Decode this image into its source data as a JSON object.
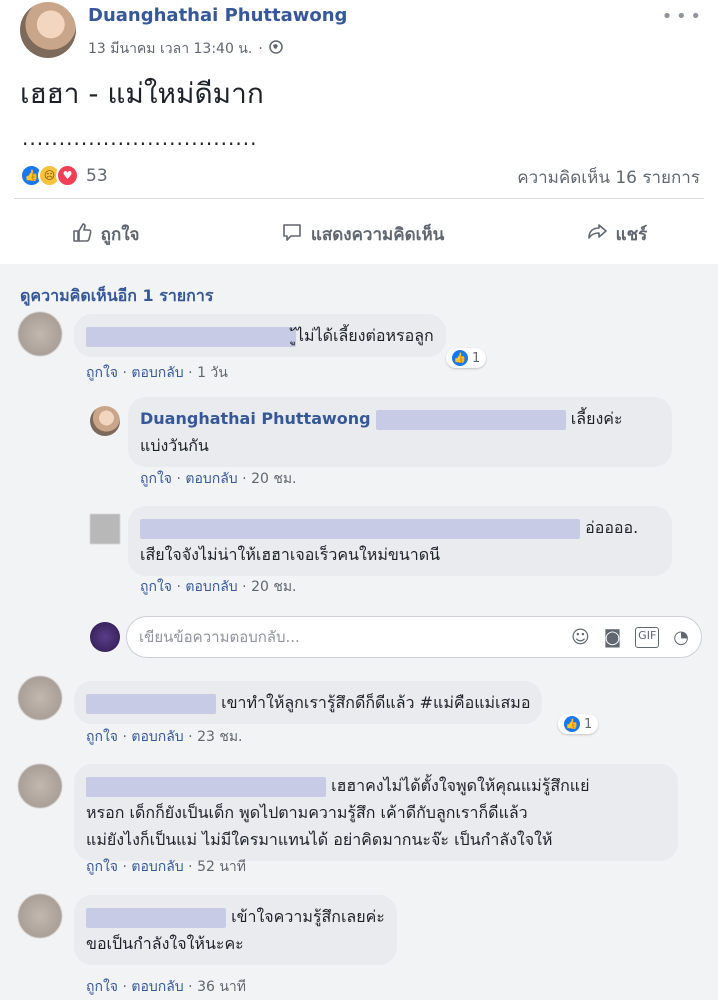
{
  "post": {
    "author": "Duanghathai Phuttawong",
    "timestamp": "13 มีนาคม เวลา 13:40 น.",
    "privacy_icon": "globe-icon",
    "text": "เฮฮา - แม่ใหม่ดีมาก",
    "dotted_line": "................................",
    "reaction_count": "53",
    "comment_count": "ความคิดเห็น 16 รายการ",
    "more_icon": "more-dots-icon"
  },
  "actions": {
    "like": "ถูกใจ",
    "comment": "แสดงความคิดเห็น",
    "share": "แชร์"
  },
  "view_more": "ดูความคิดเห็นอีก 1 รายการ",
  "comments": [
    {
      "text": "ู้ไม่ได้เลี้ยงต่อหรอลูก",
      "like": "ถูกใจ",
      "reply": "ตอบกลับ",
      "time": "1 วัน",
      "likes": "1",
      "replies": [
        {
          "name": "Duanghathai Phuttawong",
          "text_end": "เลี้ยงค่ะ",
          "text2": "แบ่งวันกัน",
          "like": "ถูกใจ",
          "reply": "ตอบกลับ",
          "time": "20 ชม."
        },
        {
          "text_end": "อ่ออออ.",
          "text2": "เสียใจจังไม่น่าให้เฮฮาเจอเร็วคนใหม่ขนาดนี",
          "like": "ถูกใจ",
          "reply": "ตอบกลับ",
          "time": "20 ชม."
        }
      ]
    },
    {
      "text": "เขาทำให้ลูกเรารู้สึกดีก็ดีแล้ว #แม่คือแม่เสมอ",
      "like": "ถูกใจ",
      "reply": "ตอบกลับ",
      "time": "23 ชม.",
      "likes": "1"
    },
    {
      "text1": "เฮฮาคงไม่ได้ตั้งใจพูดให้คุณแม่รู้สึกแย่",
      "text2": "หรอก เด็กก็ยังเป็นเด็ก พูดไปตามความรู้สึก เค้าดีกับลูกเราก็ดีแล้ว",
      "text3": "แม่ยังไงก็เป็นแม่ ไม่มีใครมาแทนได้ อย่าคิดมากนะจ๊ะ เป็นกำลังใจให้",
      "like": "ถูกใจ",
      "reply": "ตอบกลับ",
      "time": "52 นาที"
    },
    {
      "text1": "เข้าใจความรู้สึกเลยค่ะ",
      "text2": "ขอเป็นกำลังใจให้นะคะ",
      "like": "ถูกใจ",
      "reply": "ตอบกลับ",
      "time": "36 นาที"
    }
  ],
  "reply_input": {
    "placeholder": "เขียนข้อความตอบกลับ..."
  }
}
